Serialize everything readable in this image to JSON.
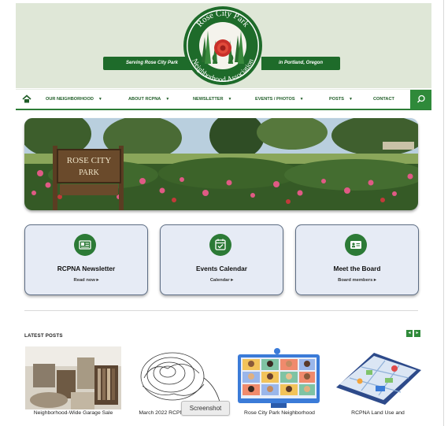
{
  "header": {
    "logo_top_text": "Rose City Park",
    "logo_bottom_text": "Neighborhood Association",
    "ribbon_left": "Serving Rose City Park",
    "ribbon_right": "in Portland, Oregon",
    "background_color": "#dfe7d7",
    "accent_color": "#1e6b2a"
  },
  "nav": {
    "home_icon": "home-icon",
    "search_icon": "search-icon",
    "items": [
      {
        "label": "OUR NEIGHBORHOOD",
        "has_dropdown": true
      },
      {
        "label": "ABOUT RCPNA",
        "has_dropdown": true
      },
      {
        "label": "NEWSLETTER",
        "has_dropdown": true
      },
      {
        "label": "EVENTS / PHOTOS",
        "has_dropdown": true
      },
      {
        "label": "POSTS",
        "has_dropdown": true
      },
      {
        "label": "CONTACT",
        "has_dropdown": false
      }
    ],
    "caret": "▼"
  },
  "hero": {
    "sign_line1": "ROSE CITY",
    "sign_line2": "PARK"
  },
  "cards": [
    {
      "title": "RCPNA Newsletter",
      "link": "Read now ▸",
      "icon": "newsletter-icon"
    },
    {
      "title": "Events Calendar",
      "link": "Calendar ▸",
      "icon": "calendar-icon"
    },
    {
      "title": "Meet the Board",
      "link": "Board members ▸",
      "icon": "id-card-icon"
    }
  ],
  "latest": {
    "label": "LATEST POSTS",
    "prev": "◂",
    "next": "▸",
    "posts": [
      {
        "caption": "Neighborhood-Wide Garage Sale"
      },
      {
        "caption": "March 2022 RCPNA Newsletter"
      },
      {
        "caption": "Rose City Park Neighborhood"
      },
      {
        "caption": "RCPNA Land Use and"
      }
    ]
  },
  "tooltip": "Screenshot"
}
